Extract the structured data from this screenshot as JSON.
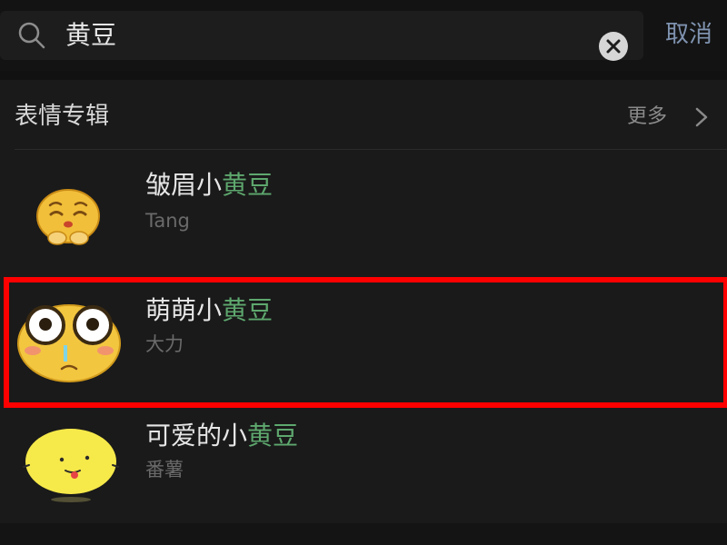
{
  "search": {
    "query": "黄豆",
    "cancel_label": "取消",
    "icons": {
      "search": "search-icon",
      "clear": "clear-icon"
    }
  },
  "section": {
    "title": "表情专辑",
    "more_label": "更多",
    "more_icon": "chevron-right-icon"
  },
  "items": [
    {
      "name_prefix": "皱眉小",
      "name_highlight": "黄豆",
      "author": "Tang",
      "icon": "worried-emoji-icon"
    },
    {
      "name_prefix": "萌萌小",
      "name_highlight": "黄豆",
      "author": "大力",
      "icon": "googly-eyes-emoji-icon"
    },
    {
      "name_prefix": "可爱的小",
      "name_highlight": "黄豆",
      "author": "番薯",
      "icon": "tongue-emoji-icon"
    }
  ],
  "colors": {
    "background": "#111111",
    "highlight_text": "#5ea86e",
    "selection_box": "#ff0000",
    "cancel_text": "#7f93b0"
  }
}
